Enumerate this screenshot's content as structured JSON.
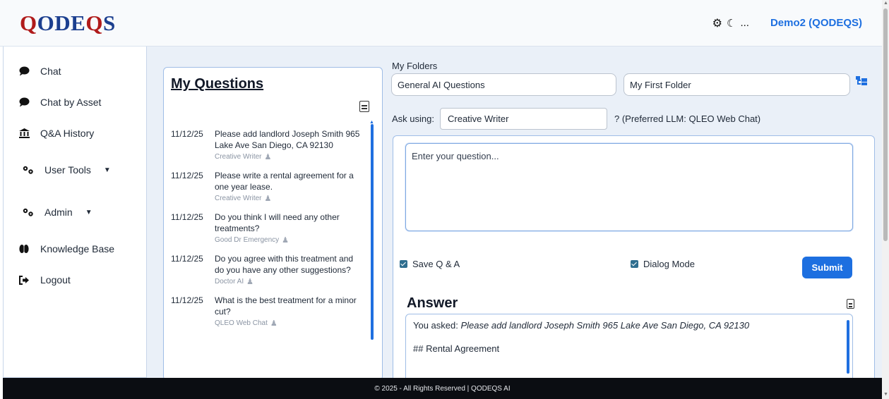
{
  "header": {
    "logo_part1": "Q",
    "logo_part2": "ODE",
    "logo_part3": "Q",
    "logo_part4": "S",
    "theme_more": "...",
    "user": "Demo2 (QODEQS)"
  },
  "sidebar": {
    "items": [
      {
        "label": "Chat",
        "icon": "chat-bubble-icon"
      },
      {
        "label": "Chat by Asset",
        "icon": "chat-bubble-icon"
      },
      {
        "label": "Q&A History",
        "icon": "bank-icon"
      },
      {
        "label": "User Tools",
        "icon": "gears-icon"
      },
      {
        "label": "Admin",
        "icon": "gears-icon"
      },
      {
        "label": "Knowledge Base",
        "icon": "brain-icon"
      },
      {
        "label": "Logout",
        "icon": "logout-icon"
      }
    ]
  },
  "questions": {
    "title": "My Questions",
    "items": [
      {
        "date": "11/12/25",
        "text": "Please add landlord Joseph Smith 965 Lake Ave San Diego, CA 92130",
        "model": "Creative Writer"
      },
      {
        "date": "11/12/25",
        "text": "Please write a rental agreement for a one year lease.",
        "model": "Creative Writer"
      },
      {
        "date": "11/12/25",
        "text": "Do you think I will need any other treatments?",
        "model": "Good Dr Emergency"
      },
      {
        "date": "11/12/25",
        "text": "Do you agree with this treatment and do you have any other suggestions?",
        "model": "Doctor AI"
      },
      {
        "date": "11/12/25",
        "text": "What is the best treatment for a minor cut?",
        "model": "QLEO Web Chat"
      }
    ]
  },
  "folders": {
    "label": "My Folders",
    "folder1": "General AI Questions",
    "folder2": "My First Folder"
  },
  "ask": {
    "label": "Ask using:",
    "value": "Creative Writer",
    "preferred": "? (Preferred LLM: QLEO Web Chat)"
  },
  "question_input": {
    "placeholder": "Enter your question..."
  },
  "options": {
    "save_label": "Save Q & A",
    "dialog_label": "Dialog Mode",
    "submit_label": "Submit"
  },
  "answer": {
    "title": "Answer",
    "asked_prefix": "You asked:",
    "asked_text": "Please add landlord Joseph Smith 965 Lake Ave San Diego, CA 92130",
    "heading_line": "## Rental Agreement"
  },
  "footer": {
    "text": "© 2025 - All Rights Reserved | QODEQS AI"
  },
  "colors": {
    "logo_red": "#b01b1b",
    "logo_blue": "#1c3f8f",
    "accent": "#1d6fe0",
    "footer_bg": "#0b0d12"
  }
}
